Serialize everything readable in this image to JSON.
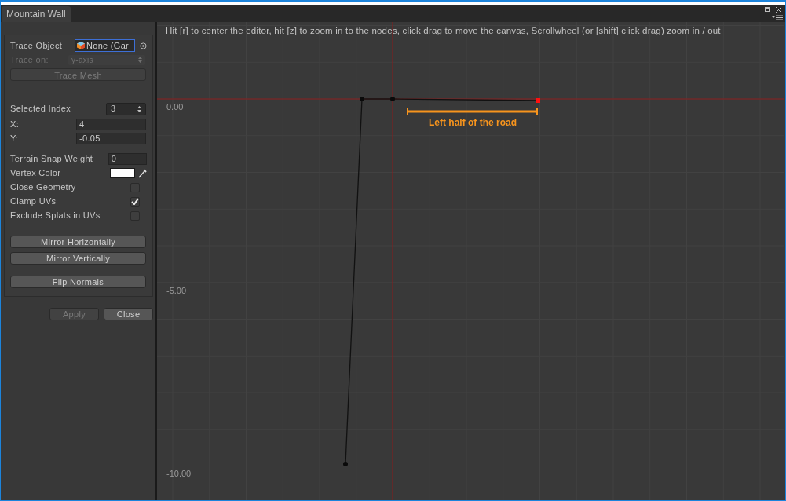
{
  "window": {
    "tab": "Mountain Wall"
  },
  "panel": {
    "trace_object": {
      "label": "Trace Object",
      "value": "None (Gar"
    },
    "trace_on": {
      "label": "Trace on:",
      "value": "y-axis",
      "disabled": true
    },
    "trace_mesh_button": {
      "label": "Trace Mesh",
      "disabled": true
    },
    "selected_index": {
      "label": "Selected Index",
      "value": "3"
    },
    "coordinates": [
      {
        "label": "X:",
        "value": "4"
      },
      {
        "label": "Y:",
        "value": "-0.05"
      }
    ],
    "terrain_snap_weight": {
      "label": "Terrain Snap Weight",
      "value": "0"
    },
    "vertex_color": {
      "label": "Vertex Color"
    },
    "toggles": [
      {
        "label": "Close Geometry",
        "checked": false
      },
      {
        "label": "Clamp UVs",
        "checked": true
      },
      {
        "label": "Exclude Splats in UVs",
        "checked": false
      }
    ],
    "button_groups": [
      [
        "Mirror Horizontally",
        "Mirror Vertically"
      ],
      [
        "Flip Normals"
      ]
    ]
  },
  "footer_buttons": [
    {
      "label": "Apply",
      "disabled": true
    },
    {
      "label": "Close",
      "disabled": false
    }
  ],
  "canvas": {
    "hint": "Hit [r] to center the editor, hit [z] to zoom in to the nodes, click drag to move the canvas, Scrollwheel (or [shift] click drag) zoom in / out",
    "axis_labels": [
      "0.00",
      "-5.00",
      "-10.00"
    ],
    "annotation": "Left half of the road"
  }
}
